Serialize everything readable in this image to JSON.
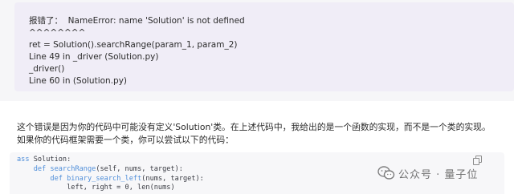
{
  "user_message": {
    "lines": [
      "报错了：  NameError: name 'Solution' is not defined",
      "^^^^^^^^",
      "ret = Solution().searchRange(param_1, param_2)",
      "Line 49 in _driver (Solution.py)",
      "_driver()",
      "Line 60 in (Solution.py)"
    ]
  },
  "assistant_message": {
    "paragraph_line_1": "这个错误是因为你的代码中可能没有定义'Solution'类。在上述代码中，我给出的是一个函数的实现，而不是一个类的实现。",
    "paragraph_line_2": "如果你的代码框架需要一个类，你可以尝试以下的代码：",
    "code": {
      "line_1_kw": "ass",
      "line_1_rest": " Solution:",
      "line_2_kw": "def",
      "line_2_fn": " searchRange",
      "line_2_rest": "(self, nums, target):",
      "line_3_kw": "def",
      "line_3_fn": " binary_search_left",
      "line_3_rest": "(nums, target):",
      "line_4": "left, right = 0, len(nums)"
    },
    "copy_icon": "copy-icon"
  },
  "watermark": {
    "icon": "wechat-official-account-icon",
    "text": "公众号 · 量子位"
  }
}
